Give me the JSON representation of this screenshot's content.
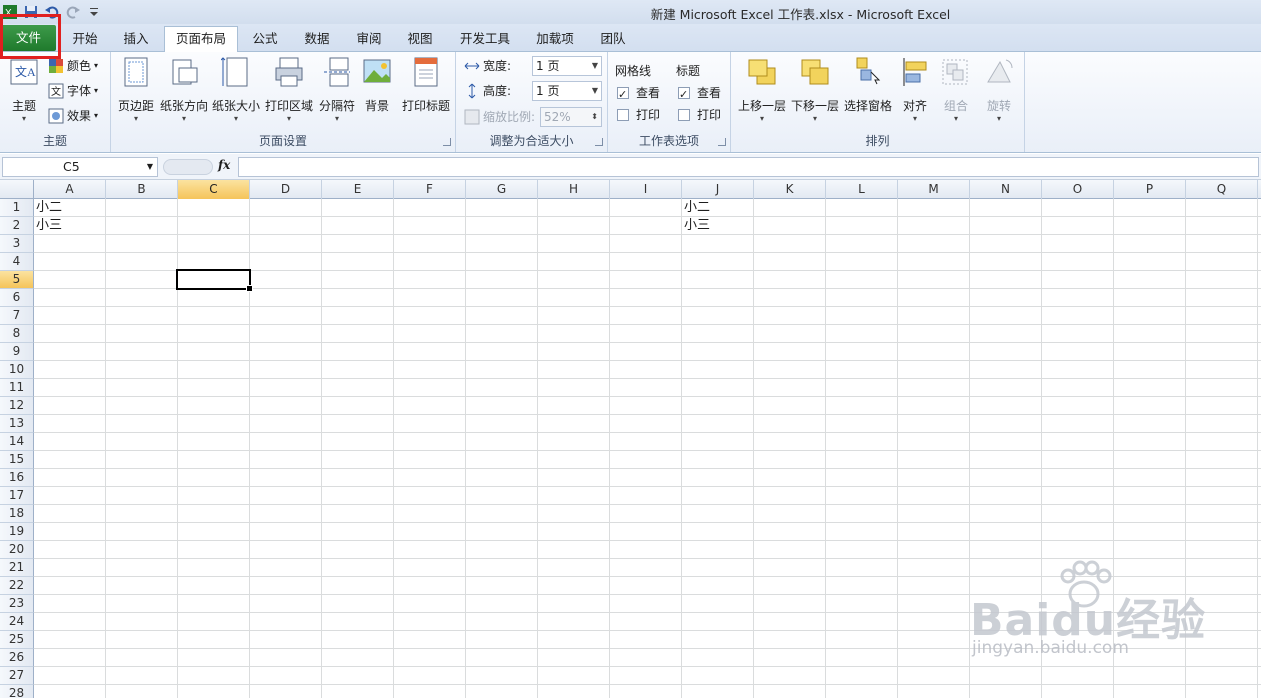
{
  "window": {
    "title": "新建 Microsoft Excel 工作表.xlsx - Microsoft Excel"
  },
  "tabs": {
    "file": "文件",
    "items": [
      "开始",
      "插入",
      "页面布局",
      "公式",
      "数据",
      "审阅",
      "视图",
      "开发工具",
      "加载项",
      "团队"
    ],
    "active": "页面布局"
  },
  "ribbon": {
    "theme_group": {
      "label": "主题",
      "themes_button": "主题",
      "colors": "颜色",
      "fonts": "字体",
      "effects": "效果"
    },
    "page_setup_group": {
      "label": "页面设置",
      "margins": "页边距",
      "orientation": "纸张方向",
      "size": "纸张大小",
      "print_area": "打印区域",
      "breaks": "分隔符",
      "background": "背景",
      "print_titles": "打印标题"
    },
    "scale_group": {
      "label": "调整为合适大小",
      "width_label": "宽度:",
      "width_value": "1 页",
      "height_label": "高度:",
      "height_value": "1 页",
      "scale_label": "缩放比例:",
      "scale_value": "52%"
    },
    "sheet_options_group": {
      "label": "工作表选项",
      "gridlines": "网格线",
      "headings": "标题",
      "view": "查看",
      "print": "打印"
    },
    "arrange_group": {
      "label": "排列",
      "bring_forward": "上移一层",
      "send_backward": "下移一层",
      "selection_pane": "选择窗格",
      "align": "对齐",
      "group": "组合",
      "rotate": "旋转"
    }
  },
  "formula_bar": {
    "name_box": "C5",
    "fx": "fx",
    "formula": ""
  },
  "sheet": {
    "columns": [
      "A",
      "B",
      "C",
      "D",
      "E",
      "F",
      "G",
      "H",
      "I",
      "J",
      "K",
      "L",
      "M",
      "N",
      "O",
      "P",
      "Q"
    ],
    "rows": [
      "1",
      "2",
      "3",
      "4",
      "5",
      "6",
      "7",
      "8",
      "9",
      "10",
      "11",
      "12",
      "13",
      "14",
      "15",
      "16",
      "17",
      "18",
      "19",
      "20",
      "21",
      "22",
      "23",
      "24",
      "25",
      "26",
      "27",
      "28"
    ],
    "selected_column": "C",
    "selected_row": "5",
    "cells": {
      "A1": "小二",
      "A2": "小三",
      "J1": "小二",
      "J2": "小三"
    }
  },
  "watermark": {
    "brand": "Baidu经验",
    "url": "jingyan.baidu.com"
  },
  "colors": {
    "file_tab": "#1f7a2c",
    "highlight_box": "#e0201f",
    "selected_header": "#f5c45a"
  }
}
